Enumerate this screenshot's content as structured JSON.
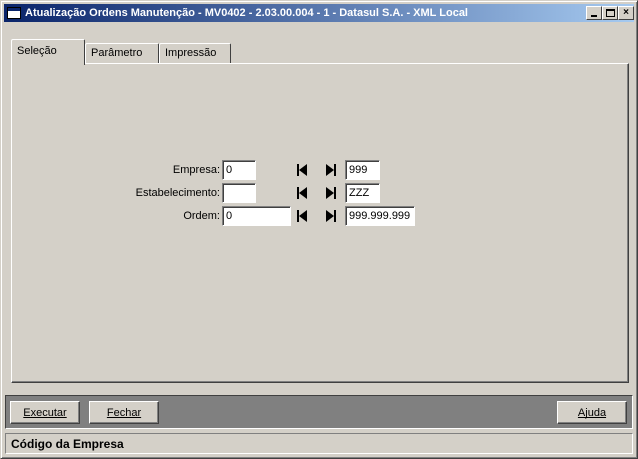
{
  "window": {
    "title": "Atualização Ordens Manutenção - MV0402 - 2.03.00.004 - 1 - Datasul S.A. - XML Local",
    "minimize_icon": "minimize-icon",
    "maximize_icon": "maximize-icon",
    "close_icon": "close-icon",
    "close_glyph": "×"
  },
  "tabs": [
    {
      "label": "Seleção",
      "active": true
    },
    {
      "label": "Parâmetro",
      "active": false
    },
    {
      "label": "Impressão",
      "active": false
    }
  ],
  "form": {
    "rows": [
      {
        "label": "Empresa:",
        "from": "0",
        "to": "999"
      },
      {
        "label": "Estabelecimento:",
        "from": "",
        "to": "ZZZ"
      },
      {
        "label": "Ordem:",
        "from": "0",
        "to": "999.999.999"
      }
    ],
    "first_icon": "first-record-icon",
    "last_icon": "last-record-icon"
  },
  "buttons": {
    "executar": "Executar",
    "fechar": "Fechar",
    "ajuda": "Ajuda"
  },
  "status": {
    "text": "Código da Empresa"
  },
  "colors": {
    "face": "#d4d0c8",
    "title_start": "#0a246a",
    "title_end": "#a6caf0",
    "button_bar": "#808080"
  }
}
